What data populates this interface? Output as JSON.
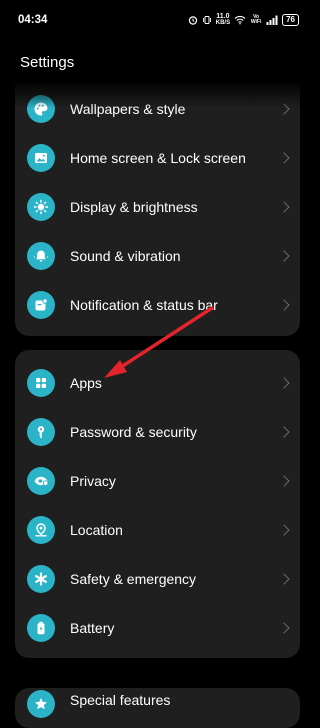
{
  "status": {
    "time": "04:34",
    "speed_value": "11.0",
    "speed_unit": "KB/S",
    "battery": "76",
    "vowifi": "Vo WiFi"
  },
  "header": {
    "title": "Settings"
  },
  "group1": [
    {
      "label": "Wallpapers & style",
      "icon": "palette-icon"
    },
    {
      "label": "Home screen & Lock screen",
      "icon": "image-icon"
    },
    {
      "label": "Display & brightness",
      "icon": "sun-icon"
    },
    {
      "label": "Sound & vibration",
      "icon": "bell-icon"
    },
    {
      "label": "Notification & status bar",
      "icon": "notification-icon"
    }
  ],
  "group2": [
    {
      "label": "Apps",
      "icon": "apps-grid-icon"
    },
    {
      "label": "Password & security",
      "icon": "key-icon"
    },
    {
      "label": "Privacy",
      "icon": "eye-shield-icon"
    },
    {
      "label": "Location",
      "icon": "location-pin-icon"
    },
    {
      "label": "Safety & emergency",
      "icon": "asterisk-icon"
    },
    {
      "label": "Battery",
      "icon": "battery-icon"
    }
  ],
  "group3": [
    {
      "label": "Special features",
      "icon": "star-icon"
    }
  ],
  "colors": {
    "accent": "#2bb3c7",
    "card": "#1f1f1f",
    "annotation_arrow": "#e3242b"
  }
}
